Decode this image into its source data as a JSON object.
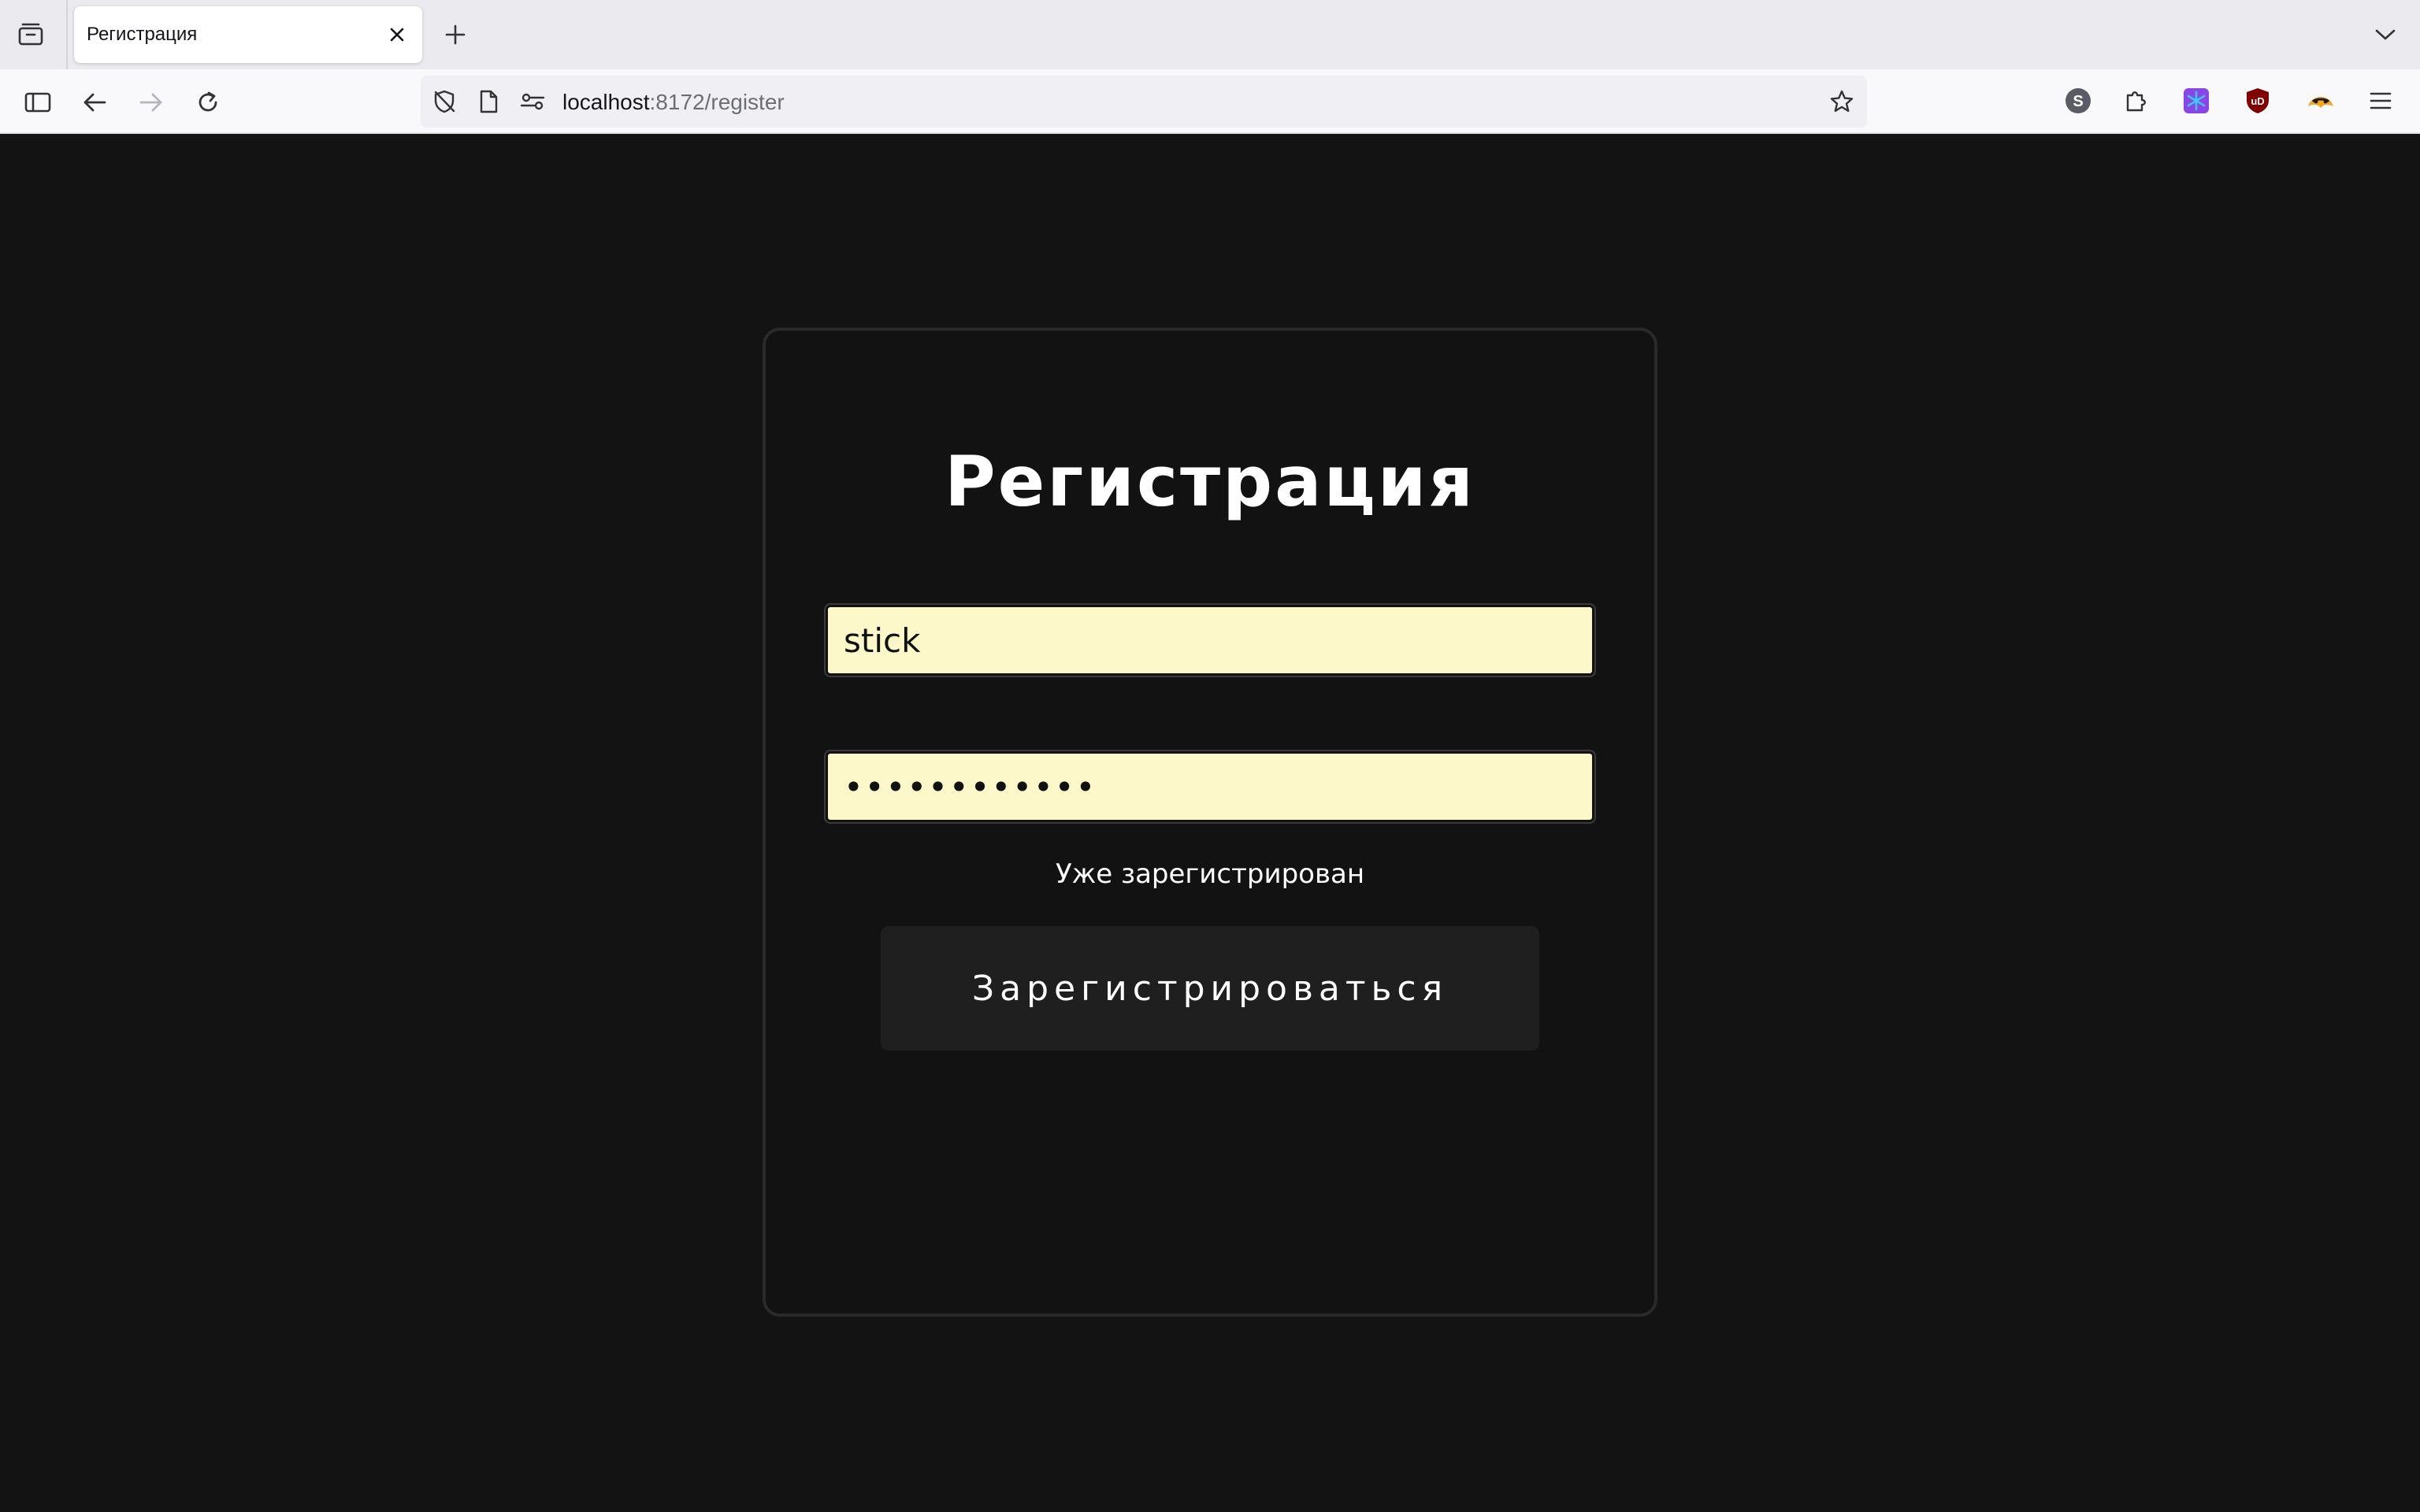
{
  "browser": {
    "tab": {
      "title": "Регистрация"
    },
    "url": {
      "host": "localhost",
      "rest": ":8172/register"
    }
  },
  "page": {
    "title": "Регистрация",
    "username_value": "stick",
    "password_value": "••••••••••••",
    "login_link": "Уже зарегистрирован",
    "submit_label": "Зарегистрироваться"
  },
  "extensions": [
    "s-avatar-icon",
    "puzzle-icon",
    "snowflake-icon",
    "ublock-icon",
    "fox-mask-icon"
  ],
  "colors": {
    "page_bg": "#131313",
    "field_bg": "#fdf8c9",
    "button_bg": "#1f1f1f",
    "text": "#ffffff"
  }
}
